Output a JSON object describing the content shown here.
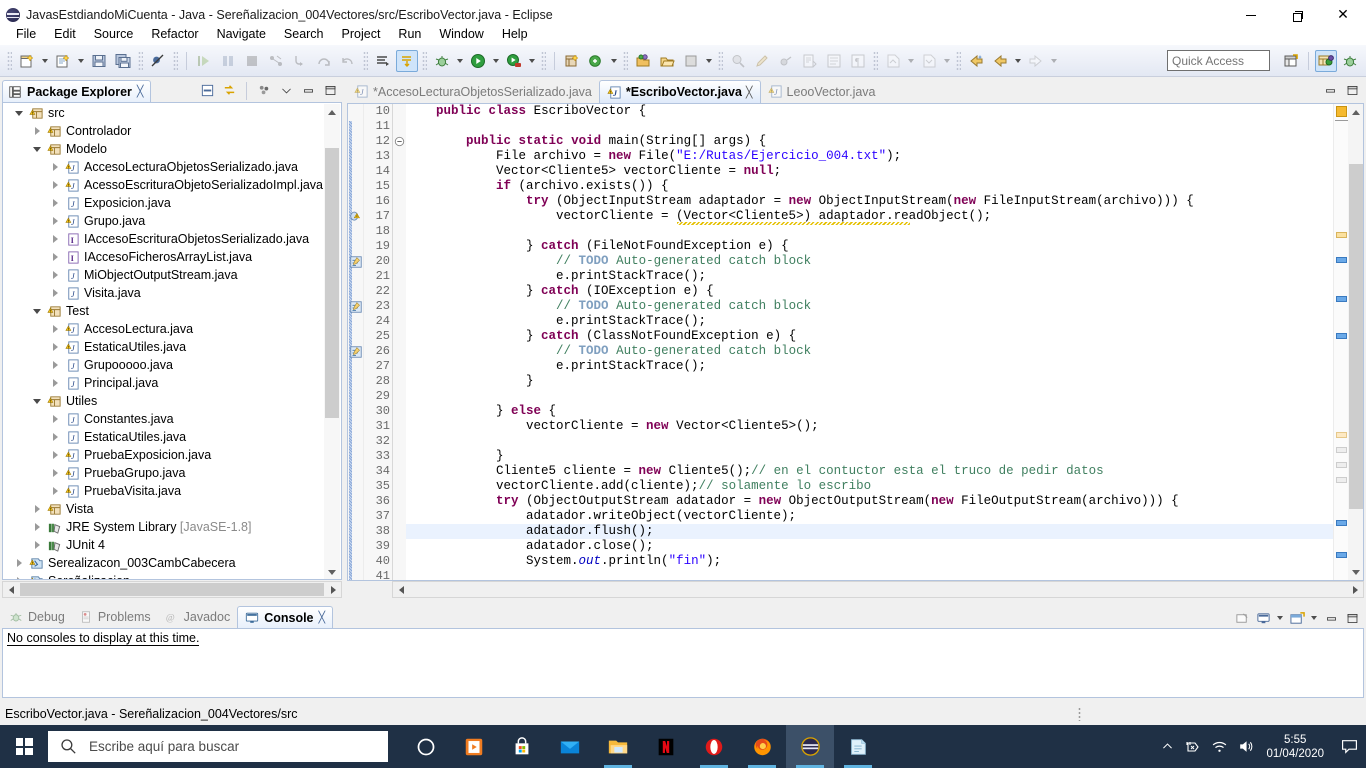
{
  "window": {
    "title": "JavasEstdiandoMiCuenta - Java - Sereñalizacion_004Vectores/src/EscriboVector.java - Eclipse",
    "app_icon": "eclipse-icon",
    "controls": {
      "minimize": "minimize-icon",
      "maximize": "maximize-icon",
      "close": "close-icon"
    }
  },
  "menubar": {
    "items": [
      "File",
      "Edit",
      "Source",
      "Refactor",
      "Navigate",
      "Search",
      "Project",
      "Run",
      "Window",
      "Help"
    ]
  },
  "toolbar": {
    "quick_access_placeholder": "Quick Access",
    "groups": [
      {
        "buttons": [
          {
            "name": "new-wizard-icon",
            "disabled": false,
            "arrow": true
          },
          {
            "name": "new-java-file-icon",
            "disabled": false,
            "arrow": true
          },
          {
            "name": "save-icon",
            "disabled": false,
            "arrow": false
          },
          {
            "name": "save-all-icon",
            "disabled": false,
            "arrow": false
          }
        ]
      },
      {
        "buttons": [
          {
            "name": "skip-all-breakpoints-icon",
            "disabled": false,
            "arrow": false
          }
        ]
      },
      {
        "buttons": [
          {
            "name": "resume-icon",
            "disabled": true,
            "arrow": false
          },
          {
            "name": "suspend-icon",
            "disabled": true,
            "arrow": false
          },
          {
            "name": "terminate-icon",
            "disabled": true,
            "arrow": false
          },
          {
            "name": "disconnect-icon",
            "disabled": true,
            "arrow": false
          },
          {
            "name": "step-into-icon",
            "disabled": true,
            "arrow": false
          },
          {
            "name": "step-over-icon",
            "disabled": true,
            "arrow": false
          },
          {
            "name": "step-return-icon",
            "disabled": true,
            "arrow": false
          }
        ]
      },
      {
        "buttons": [
          {
            "name": "next-annotation-icon",
            "disabled": false,
            "arrow": false
          },
          {
            "name": "toggle-mark-occurrences-icon",
            "disabled": false,
            "arrow": false,
            "selected": true
          }
        ]
      },
      {
        "buttons": [
          {
            "name": "debug-icon",
            "disabled": false,
            "arrow": true
          },
          {
            "name": "run-icon",
            "disabled": false,
            "arrow": true
          },
          {
            "name": "run-external-tools-icon",
            "disabled": false,
            "arrow": true
          }
        ]
      },
      {
        "buttons": [
          {
            "name": "new-java-project-icon",
            "disabled": false,
            "arrow": false
          },
          {
            "name": "new-java-class-icon",
            "disabled": false,
            "arrow": true
          }
        ]
      },
      {
        "buttons": [
          {
            "name": "open-type-icon",
            "disabled": false,
            "arrow": false
          },
          {
            "name": "open-task-icon",
            "disabled": false,
            "arrow": false
          },
          {
            "name": "new-task-icon",
            "disabled": false,
            "arrow": true
          }
        ]
      },
      {
        "buttons": [
          {
            "name": "search-icon",
            "disabled": true,
            "arrow": false
          },
          {
            "name": "pencil-icon",
            "disabled": true,
            "arrow": false
          },
          {
            "name": "link-icon",
            "disabled": true,
            "arrow": false
          },
          {
            "name": "open-declaration-icon",
            "disabled": true,
            "arrow": false
          },
          {
            "name": "outline-icon",
            "disabled": true,
            "arrow": false
          },
          {
            "name": "paragraph-icon",
            "disabled": true,
            "arrow": false
          }
        ]
      },
      {
        "buttons": [
          {
            "name": "previous-edit-location-icon",
            "disabled": true,
            "arrow": true
          },
          {
            "name": "next-edit-location-icon",
            "disabled": true,
            "arrow": true
          }
        ]
      },
      {
        "buttons": [
          {
            "name": "back-history-icon",
            "disabled": false,
            "arrow": false
          },
          {
            "name": "back-icon",
            "disabled": false,
            "arrow": true
          },
          {
            "name": "forward-icon",
            "disabled": true,
            "arrow": true
          }
        ]
      }
    ],
    "right_buttons": [
      {
        "name": "open-perspective-icon"
      },
      {
        "name": "java-perspective-icon",
        "selected": true
      },
      {
        "name": "debug-perspective-icon"
      }
    ]
  },
  "package_explorer": {
    "tab_label": "Package Explorer",
    "tab_close": "close-icon",
    "tools": [
      "collapse-all-icon",
      "link-with-editor-icon",
      "view-menu-icon",
      "minimize-icon",
      "maximize-icon"
    ],
    "tree": [
      {
        "depth": 1,
        "expander": "down",
        "icon": "source-folder-icon",
        "label": "src",
        "suffix": ""
      },
      {
        "depth": 2,
        "expander": "right",
        "icon": "package-icon",
        "label": "Controlador",
        "suffix": ""
      },
      {
        "depth": 2,
        "expander": "down",
        "icon": "package-icon",
        "label": "Modelo",
        "suffix": ""
      },
      {
        "depth": 3,
        "expander": "right",
        "icon": "java-warn-icon",
        "label": "AccesoLecturaObjetosSerializado.java",
        "suffix": ""
      },
      {
        "depth": 3,
        "expander": "right",
        "icon": "java-warn-icon",
        "label": "AcessoEscrituraObjetoSerializadoImpl.java",
        "suffix": ""
      },
      {
        "depth": 3,
        "expander": "right",
        "icon": "java-icon",
        "label": "Exposicion.java",
        "suffix": ""
      },
      {
        "depth": 3,
        "expander": "right",
        "icon": "java-warn-icon",
        "label": "Grupo.java",
        "suffix": ""
      },
      {
        "depth": 3,
        "expander": "right",
        "icon": "interface-icon",
        "label": "IAccesoEscrituraObjetosSerializado.java",
        "suffix": ""
      },
      {
        "depth": 3,
        "expander": "right",
        "icon": "interface-icon",
        "label": "IAccesoFicherosArrayList.java",
        "suffix": ""
      },
      {
        "depth": 3,
        "expander": "right",
        "icon": "java-icon",
        "label": "MiObjectOutputStream.java",
        "suffix": ""
      },
      {
        "depth": 3,
        "expander": "right",
        "icon": "java-icon",
        "label": "Visita.java",
        "suffix": ""
      },
      {
        "depth": 2,
        "expander": "down",
        "icon": "package-icon",
        "label": "Test",
        "suffix": ""
      },
      {
        "depth": 3,
        "expander": "right",
        "icon": "java-warn-icon",
        "label": "AccesoLectura.java",
        "suffix": ""
      },
      {
        "depth": 3,
        "expander": "right",
        "icon": "java-warn-icon",
        "label": "EstaticaUtiles.java",
        "suffix": ""
      },
      {
        "depth": 3,
        "expander": "right",
        "icon": "java-icon",
        "label": "Grupooooo.java",
        "suffix": ""
      },
      {
        "depth": 3,
        "expander": "right",
        "icon": "java-icon",
        "label": "Principal.java",
        "suffix": ""
      },
      {
        "depth": 2,
        "expander": "down",
        "icon": "package-icon",
        "label": "Utiles",
        "suffix": ""
      },
      {
        "depth": 3,
        "expander": "right",
        "icon": "java-icon",
        "label": "Constantes.java",
        "suffix": ""
      },
      {
        "depth": 3,
        "expander": "right",
        "icon": "java-icon",
        "label": "EstaticaUtiles.java",
        "suffix": ""
      },
      {
        "depth": 3,
        "expander": "right",
        "icon": "java-warn-icon",
        "label": "PruebaExposicion.java",
        "suffix": ""
      },
      {
        "depth": 3,
        "expander": "right",
        "icon": "java-warn-icon",
        "label": "PruebaGrupo.java",
        "suffix": ""
      },
      {
        "depth": 3,
        "expander": "right",
        "icon": "java-warn-icon",
        "label": "PruebaVisita.java",
        "suffix": ""
      },
      {
        "depth": 2,
        "expander": "right",
        "icon": "package-icon",
        "label": "Vista",
        "suffix": ""
      },
      {
        "depth": 2,
        "expander": "right",
        "icon": "library-icon",
        "label": "JRE System Library ",
        "suffix": "[JavaSE-1.8]"
      },
      {
        "depth": 2,
        "expander": "right",
        "icon": "library-icon",
        "label": "JUnit 4",
        "suffix": ""
      },
      {
        "depth": 1,
        "expander": "right",
        "icon": "project-icon",
        "label": "Serealizacon_003CambCabecera",
        "suffix": ""
      },
      {
        "depth": 1,
        "expander": "right",
        "icon": "project-icon",
        "label": "Sereñalizacion",
        "suffix": ""
      }
    ]
  },
  "editor": {
    "tabs": [
      {
        "label": "*AccesoLecturaObjetosSerializado.java",
        "icon": "java-warn-icon",
        "active": false,
        "closable": false
      },
      {
        "label": "*EscriboVector.java",
        "icon": "java-warn-icon",
        "active": true,
        "closable": true
      },
      {
        "label": "LeooVector.java",
        "icon": "java-warn-icon",
        "active": false,
        "closable": false
      }
    ],
    "first_line_number": 10,
    "current_line": 38,
    "lines": [
      {
        "no": 10,
        "text": "public class EscriboVector {",
        "indent": 1,
        "clipped_top": true
      },
      {
        "no": 11,
        "text": ""
      },
      {
        "no": 12,
        "text": "public static void main(String[] args) {",
        "fold": true
      },
      {
        "no": 13,
        "text": "File archivo = new File(\"E:/Rutas/Ejercicio_004.txt\");"
      },
      {
        "no": 14,
        "text": "Vector<Cliente5> vectorCliente = null;"
      },
      {
        "no": 15,
        "text": "if (archivo.exists()) {"
      },
      {
        "no": 16,
        "text": "try (ObjectInputStream adaptador = new ObjectInputStream(new FileInputStream(archivo))) {"
      },
      {
        "no": 17,
        "text": "vectorCliente = (Vector<Cliente5>) adaptador.readObject();",
        "marker": "warning"
      },
      {
        "no": 18,
        "text": ""
      },
      {
        "no": 19,
        "text": "} catch (FileNotFoundException e) {"
      },
      {
        "no": 20,
        "text": "// TODO Auto-generated catch block",
        "marker": "todo"
      },
      {
        "no": 21,
        "text": "e.printStackTrace();"
      },
      {
        "no": 22,
        "text": "} catch (IOException e) {"
      },
      {
        "no": 23,
        "text": "// TODO Auto-generated catch block",
        "marker": "todo"
      },
      {
        "no": 24,
        "text": "e.printStackTrace();"
      },
      {
        "no": 25,
        "text": "} catch (ClassNotFoundException e) {"
      },
      {
        "no": 26,
        "text": "// TODO Auto-generated catch block",
        "marker": "todo"
      },
      {
        "no": 27,
        "text": "e.printStackTrace();"
      },
      {
        "no": 28,
        "text": "}"
      },
      {
        "no": 29,
        "text": ""
      },
      {
        "no": 30,
        "text": "} else {"
      },
      {
        "no": 31,
        "text": "vectorCliente = new Vector<Cliente5>();"
      },
      {
        "no": 32,
        "text": ""
      },
      {
        "no": 33,
        "text": "}"
      },
      {
        "no": 34,
        "text": "Cliente5 cliente = new Cliente5();// en el contuctor esta el truco de pedir datos"
      },
      {
        "no": 35,
        "text": "vectorCliente.add(cliente);// solamente lo escribo"
      },
      {
        "no": 36,
        "text": "try (ObjectOutputStream adatador = new ObjectOutputStream(new FileOutputStream(archivo))) {"
      },
      {
        "no": 37,
        "text": "adatador.writeObject(vectorCliente);"
      },
      {
        "no": 38,
        "text": "adatador.flush();"
      },
      {
        "no": 39,
        "text": "adatador.close();"
      },
      {
        "no": 40,
        "text": "System.out.println(\"fin\");"
      },
      {
        "no": 41,
        "text": ""
      }
    ]
  },
  "bottom_panel": {
    "tabs": [
      {
        "label": "Debug",
        "icon": "debug-icon",
        "active": false,
        "closable": false
      },
      {
        "label": "Problems",
        "icon": "problems-icon",
        "active": false,
        "closable": false
      },
      {
        "label": "Javadoc",
        "icon": "javadoc-icon",
        "active": false,
        "closable": false
      },
      {
        "label": "Console",
        "icon": "console-icon",
        "active": true,
        "closable": true
      }
    ],
    "message": "No consoles to display at this time.",
    "tools": [
      "clear-console-icon",
      "display-selected-console-icon",
      "open-console-icon",
      "minimize-icon",
      "maximize-icon"
    ]
  },
  "statusbar": {
    "text": "EscriboVector.java - Sereñalizacion_004Vectores/src"
  },
  "taskbar": {
    "start": "windows-logo-icon",
    "search_placeholder": "Escribe aquí para buscar",
    "search_icon": "search-icon",
    "pinned": [
      {
        "name": "cortana-icon",
        "running": false
      },
      {
        "name": "movies-tv-icon",
        "running": false
      },
      {
        "name": "microsoft-store-icon",
        "running": false
      },
      {
        "name": "mail-icon",
        "running": false
      },
      {
        "name": "file-explorer-icon",
        "running": true
      },
      {
        "name": "netflix-icon",
        "running": false
      },
      {
        "name": "opera-icon",
        "running": true
      },
      {
        "name": "firefox-icon",
        "running": true
      },
      {
        "name": "eclipse-icon",
        "running": true,
        "active": true
      },
      {
        "name": "notepad-icon",
        "running": true
      }
    ],
    "tray": {
      "show_hidden": "chevron-up-icon",
      "icons": [
        "usb-eject-icon",
        "wifi-icon",
        "volume-icon"
      ],
      "time": "5:55",
      "date": "01/04/2020",
      "action_center": "notification-icon"
    }
  },
  "colors": {
    "keyword": "#7f0055",
    "string": "#2a00ff",
    "comment": "#3f7f5f",
    "todo_tag": "#7f9fbf",
    "field": "#0000c0",
    "current_line": "#eaf2fe",
    "occurrence_highlight": "#d4d4d4",
    "selection_highlight": "#ffe9b5",
    "taskbar_bg": "#1f3045",
    "accent_tab": "#dfeafa"
  }
}
